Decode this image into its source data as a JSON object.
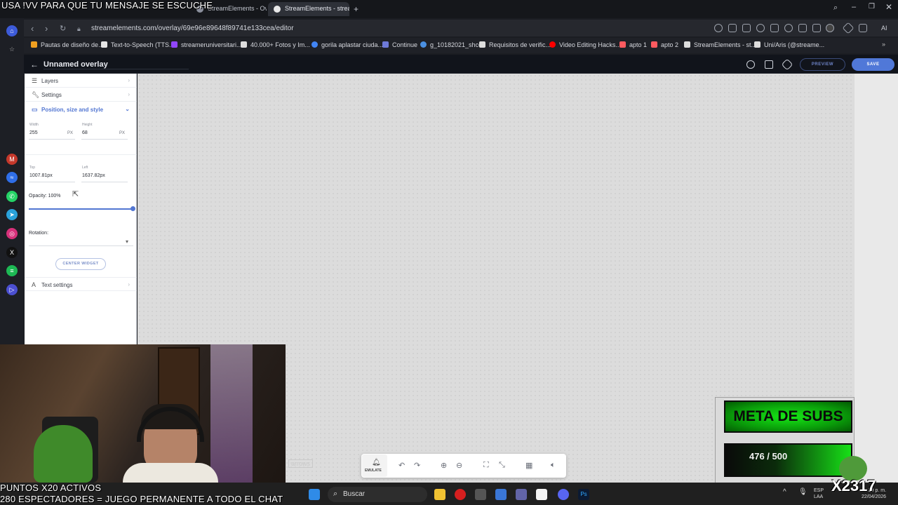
{
  "overlay_text": {
    "top": "USA !VV PARA QUE TU MENSAJE SE ESCUCHE",
    "bottom_line1": "PUNTOS X20 ACTIVOS",
    "bottom_line2": "280 ESPECTADORES = JUEGO PERMANENTE A TODO EL CHAT",
    "frog_tag": "X2317"
  },
  "browser": {
    "tabs": [
      {
        "label": "StreamElements - Overlay"
      },
      {
        "label": "StreamElements - streame"
      }
    ],
    "url": "streamelements.com/overlay/69e96e89648f89741e133cea/editor",
    "bookmarks": [
      {
        "label": "Pautas de diseño de...",
        "color": "#f0a020"
      },
      {
        "label": "Text-to-Speech (TTS...",
        "color": "#e5e5e5"
      },
      {
        "label": "streameruniversitari...",
        "color": "#9146ff"
      },
      {
        "label": "40.000+ Fotos y Im...",
        "color": "#dddddd"
      },
      {
        "label": "gorila aplastar ciuda...",
        "color": "#4285f4"
      },
      {
        "label": "Continue",
        "color": "#6e7ad8"
      },
      {
        "label": "g_10182021_shcc",
        "color": "#4a90e2"
      },
      {
        "label": "Requisitos de verific...",
        "color": "#dddddd"
      },
      {
        "label": "Video Editing Hacks...",
        "color": "#ff0000"
      },
      {
        "label": "apto 1",
        "color": "#ff5a5f"
      },
      {
        "label": "apto 2",
        "color": "#ff5a5f"
      },
      {
        "label": "StreamElements - st...",
        "color": "#dddddd"
      },
      {
        "label": "Uni/Aris (@streame...",
        "color": "#dddddd"
      }
    ]
  },
  "editor": {
    "title": "Unnamed overlay",
    "preview_label": "PREVIEW",
    "save_label": "SAVE"
  },
  "panel": {
    "layers": "Layers",
    "settings": "Settings",
    "position_section": "Position, size and style",
    "width_label": "Width",
    "width_value": "255",
    "width_unit": "PX",
    "height_label": "Height",
    "height_value": "68",
    "height_unit": "PX",
    "top_label": "Top",
    "top_value": "1007.81px",
    "left_label": "Left",
    "left_value": "1637.82px",
    "opacity_label": "Opacity: 100%",
    "opacity_value": 1.0,
    "rotation_label": "Rotation:",
    "center_widget": "CENTER WIDGET",
    "text_settings": "Text settings"
  },
  "widget": {
    "meta_title": "META DE SUBS",
    "progress_text": "476 / 500"
  },
  "toolbar": {
    "emulate": "EMULATE",
    "arrows_tag": "arrows"
  },
  "taskbar": {
    "search_placeholder": "Buscar",
    "lang": "ESP",
    "lang2": "LAA",
    "time": "...39 p. m.",
    "date": "22/04/2026"
  },
  "colors": {
    "accent": "#5276d2",
    "save_button": "#5078d8",
    "meta_green": "#16e916"
  }
}
